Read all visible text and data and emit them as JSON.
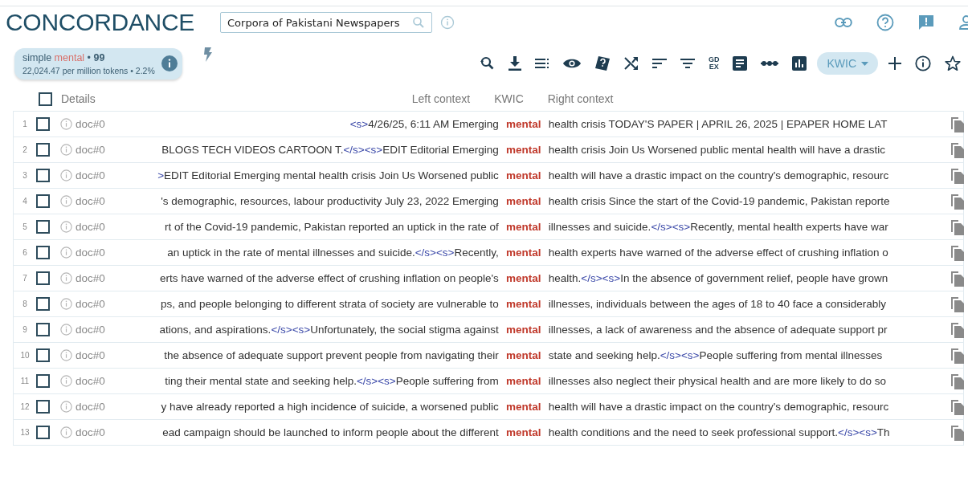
{
  "app": {
    "title": "CONCORDANCE"
  },
  "corpus_search": {
    "value": "Corpora of Pakistani Newspapers"
  },
  "query": {
    "type": "simple",
    "term": "mental",
    "separator": "•",
    "hits": "99",
    "frequency": "22,024.47 per million tokens",
    "separator_2": "•",
    "percent": "2.2%"
  },
  "toolbar": {
    "gdex_label": [
      "GD",
      "EX"
    ],
    "view_mode": "KWIC"
  },
  "table": {
    "columns": [
      "Details",
      "Left context",
      "KWIC",
      "Right context"
    ],
    "all_checked": false,
    "rows": [
      {
        "number": "1",
        "checked": false,
        "doc": "doc#0",
        "left": [
          {
            "kind": "tag",
            "text": "<s>"
          },
          {
            "kind": "word",
            "text": "4/26/25, 6:11 AM Emerging"
          }
        ],
        "kwic": "mental",
        "right": [
          {
            "kind": "word",
            "text": "health crisis TODAY'S PAPER | APRIL 26, 2025 | EPAPER HOME LAT"
          }
        ]
      },
      {
        "number": "2",
        "checked": false,
        "doc": "doc#0",
        "left": [
          {
            "kind": "word",
            "text": "BLOGS TECH VIDEOS CARTOON T."
          },
          {
            "kind": "tag",
            "text": "</s><s>"
          },
          {
            "kind": "word",
            "text": "EDIT Editorial Emerging"
          }
        ],
        "kwic": "mental",
        "right": [
          {
            "kind": "word",
            "text": "health crisis Join Us Worsened public mental health will have a drastic"
          }
        ]
      },
      {
        "number": "3",
        "checked": false,
        "doc": "doc#0",
        "left": [
          {
            "kind": "tag",
            "text": ">"
          },
          {
            "kind": "word",
            "text": "EDIT Editorial Emerging mental health crisis Join Us Worsened public"
          }
        ],
        "kwic": "mental",
        "right": [
          {
            "kind": "word",
            "text": "health will have a drastic impact on the country's demographic, resourc"
          }
        ]
      },
      {
        "number": "4",
        "checked": false,
        "doc": "doc#0",
        "left": [
          {
            "kind": "word",
            "text": "'s demographic, resources, labour productivity July 23, 2022 Emerging"
          }
        ],
        "kwic": "mental",
        "right": [
          {
            "kind": "word",
            "text": "health crisis Since the start of the Covid-19 pandemic, Pakistan reporte"
          }
        ]
      },
      {
        "number": "5",
        "checked": false,
        "doc": "doc#0",
        "left": [
          {
            "kind": "word",
            "text": "rt of the Covid-19 pandemic, Pakistan reported an uptick in the rate of"
          }
        ],
        "kwic": "mental",
        "right": [
          {
            "kind": "word",
            "text": "illnesses and suicide."
          },
          {
            "kind": "tag",
            "text": "</s><s>"
          },
          {
            "kind": "word",
            "text": "Recently, mental health experts have war"
          }
        ]
      },
      {
        "number": "6",
        "checked": false,
        "doc": "doc#0",
        "left": [
          {
            "kind": "word",
            "text": "an uptick in the rate of mental illnesses and suicide."
          },
          {
            "kind": "tag",
            "text": "</s><s>"
          },
          {
            "kind": "word",
            "text": "Recently,"
          }
        ],
        "kwic": "mental",
        "right": [
          {
            "kind": "word",
            "text": "health experts have warned of the adverse effect of crushing inflation o"
          }
        ]
      },
      {
        "number": "7",
        "checked": false,
        "doc": "doc#0",
        "left": [
          {
            "kind": "word",
            "text": "erts have warned of the adverse effect of crushing inflation on people's"
          }
        ],
        "kwic": "mental",
        "right": [
          {
            "kind": "word",
            "text": "health."
          },
          {
            "kind": "tag",
            "text": "</s><s>"
          },
          {
            "kind": "word",
            "text": "In the absence of government relief, people have grown"
          }
        ]
      },
      {
        "number": "8",
        "checked": false,
        "doc": "doc#0",
        "left": [
          {
            "kind": "word",
            "text": "ps, and people belonging to different strata of society are vulnerable to"
          }
        ],
        "kwic": "mental",
        "right": [
          {
            "kind": "word",
            "text": "illnesses, individuals between the ages of 18 to 40 face a considerably"
          }
        ]
      },
      {
        "number": "9",
        "checked": false,
        "doc": "doc#0",
        "left": [
          {
            "kind": "word",
            "text": "ations, and aspirations."
          },
          {
            "kind": "tag",
            "text": "</s><s>"
          },
          {
            "kind": "word",
            "text": "Unfortunately, the social stigma against"
          }
        ],
        "kwic": "mental",
        "right": [
          {
            "kind": "word",
            "text": "illnesses, a lack of awareness and the absence of adequate support pr"
          }
        ]
      },
      {
        "number": "10",
        "checked": false,
        "doc": "doc#0",
        "left": [
          {
            "kind": "word",
            "text": "the absence of adequate support prevent people from navigating their"
          }
        ],
        "kwic": "mental",
        "right": [
          {
            "kind": "word",
            "text": "state and seeking help."
          },
          {
            "kind": "tag",
            "text": "</s><s>"
          },
          {
            "kind": "word",
            "text": "People suffering from mental illnesses"
          }
        ]
      },
      {
        "number": "11",
        "checked": false,
        "doc": "doc#0",
        "left": [
          {
            "kind": "word",
            "text": "ting their mental state and seeking help."
          },
          {
            "kind": "tag",
            "text": "</s><s>"
          },
          {
            "kind": "word",
            "text": "People suffering from"
          }
        ],
        "kwic": "mental",
        "right": [
          {
            "kind": "word",
            "text": "illnesses also neglect their physical health and are more likely to do so"
          }
        ]
      },
      {
        "number": "12",
        "checked": false,
        "doc": "doc#0",
        "left": [
          {
            "kind": "word",
            "text": "y have already reported a high incidence of suicide, a worsened public"
          }
        ],
        "kwic": "mental",
        "right": [
          {
            "kind": "word",
            "text": "health will have a drastic impact on the country's demographic, resourc"
          }
        ]
      },
      {
        "number": "13",
        "checked": false,
        "doc": "doc#0",
        "left": [
          {
            "kind": "word",
            "text": "ead campaign should be launched to inform people about the different"
          }
        ],
        "kwic": "mental",
        "right": [
          {
            "kind": "word",
            "text": "health conditions and the need to seek professional support."
          },
          {
            "kind": "tag",
            "text": "</s><s>"
          },
          {
            "kind": "word",
            "text": "Th"
          }
        ]
      }
    ]
  }
}
